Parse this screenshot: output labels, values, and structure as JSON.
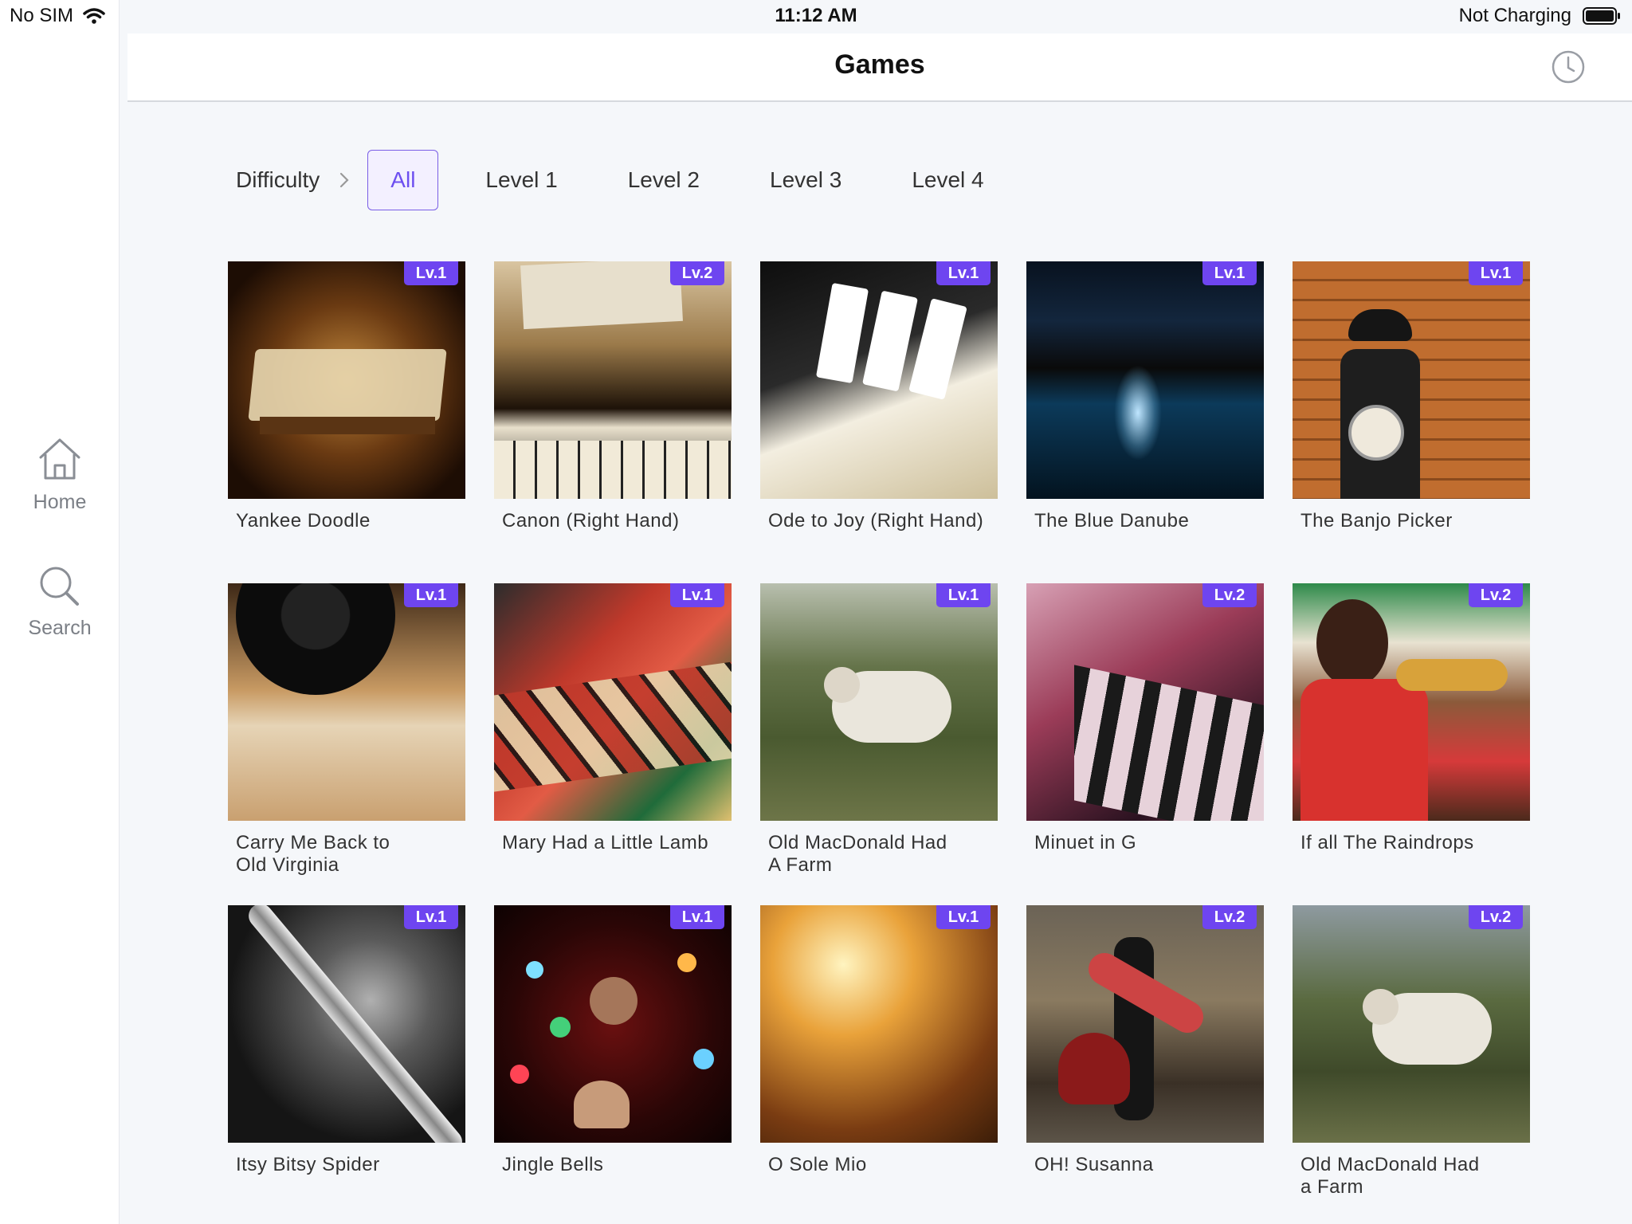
{
  "status_bar": {
    "carrier": "No SIM",
    "time": "11:12 AM",
    "battery_text": "Not Charging"
  },
  "sidebar": {
    "items": [
      {
        "label": "Home",
        "icon": "home-icon"
      },
      {
        "label": "Search",
        "icon": "search-icon"
      }
    ]
  },
  "header": {
    "title": "Games",
    "history_icon": "clock-icon"
  },
  "filters": {
    "label": "Difficulty",
    "tabs": [
      "All",
      "Level 1",
      "Level 2",
      "Level 3",
      "Level 4"
    ],
    "active": "All"
  },
  "colors": {
    "accent": "#6e45f0",
    "badge_text": "#ffffff"
  },
  "songs": [
    {
      "title": "Yankee Doodle",
      "level": "Lv.1"
    },
    {
      "title": "Canon (Right Hand)",
      "level": "Lv.2"
    },
    {
      "title": "Ode to Joy (Right Hand)",
      "level": "Lv.1"
    },
    {
      "title": "The Blue Danube",
      "level": "Lv.1"
    },
    {
      "title": "The Banjo Picker",
      "level": "Lv.1"
    },
    {
      "title": "Carry Me Back to\nOld Virginia",
      "level": "Lv.1"
    },
    {
      "title": "Mary Had a Little Lamb",
      "level": "Lv.1"
    },
    {
      "title": "Old MacDonald Had\nA Farm",
      "level": "Lv.1"
    },
    {
      "title": "Minuet in G",
      "level": "Lv.2"
    },
    {
      "title": "If all The Raindrops",
      "level": "Lv.2"
    },
    {
      "title": "Itsy Bitsy Spider",
      "level": "Lv.1"
    },
    {
      "title": "Jingle Bells",
      "level": "Lv.1"
    },
    {
      "title": "O Sole Mio",
      "level": "Lv.1"
    },
    {
      "title": "OH! Susanna",
      "level": "Lv.2"
    },
    {
      "title": "Old MacDonald Had\na Farm",
      "level": "Lv.2"
    }
  ]
}
